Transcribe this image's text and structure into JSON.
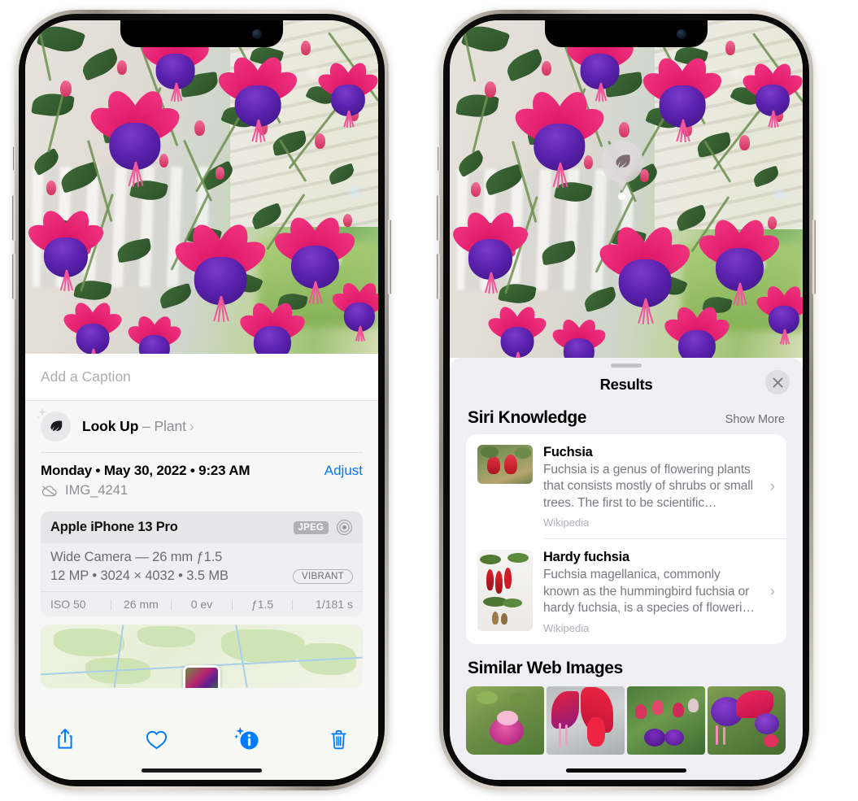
{
  "left_phone": {
    "caption_placeholder": "Add a Caption",
    "lookup": {
      "label": "Look Up",
      "dash": " – ",
      "subject": "Plant",
      "chevron": "›",
      "icon": "leaf-icon"
    },
    "date_text": "Monday • May 30, 2022 • 9:23 AM",
    "adjust_label": "Adjust",
    "file_name": "IMG_4241",
    "cloud_icon": "icloud-slash-icon",
    "camera": {
      "model": "Apple iPhone 13 Pro",
      "format_badge": "JPEG",
      "lens_icon": "aperture-icon",
      "lens": "Wide Camera — 26 mm ƒ1.5",
      "meta": "12 MP • 3024 × 4032 • 3.5 MB",
      "style_pill": "VIBRANT",
      "exif": [
        "ISO 50",
        "26 mm",
        "0 ev",
        "ƒ1.5",
        "1/181 s"
      ]
    },
    "toolbar": [
      {
        "name": "share-button",
        "icon": "share-icon"
      },
      {
        "name": "favorite-button",
        "icon": "heart-icon"
      },
      {
        "name": "info-button",
        "icon": "info-sparkle-icon"
      },
      {
        "name": "delete-button",
        "icon": "trash-icon"
      }
    ],
    "accent_color": "#007aff"
  },
  "right_phone": {
    "visual_lookup_badge": {
      "icon": "leaf-icon",
      "name": "visual-lookup-badge"
    },
    "results_title": "Results",
    "close_icon": "close-icon",
    "sections": [
      {
        "title": "Siri Knowledge",
        "action": "Show More",
        "items": [
          {
            "title": "Fuchsia",
            "description": "Fuchsia is a genus of flowering plants that consists mostly of shrubs or small trees. The first to be scientific…",
            "source": "Wikipedia",
            "chevron": "›"
          },
          {
            "title": "Hardy fuchsia",
            "description": "Fuchsia magellanica, commonly known as the hummingbird fuchsia or hardy fuchsia, is a species of floweri…",
            "source": "Wikipedia",
            "chevron": "›"
          }
        ]
      },
      {
        "title": "Similar Web Images",
        "thumbnails": [
          "web-image-1",
          "web-image-2",
          "web-image-3",
          "web-image-4"
        ]
      }
    ]
  }
}
